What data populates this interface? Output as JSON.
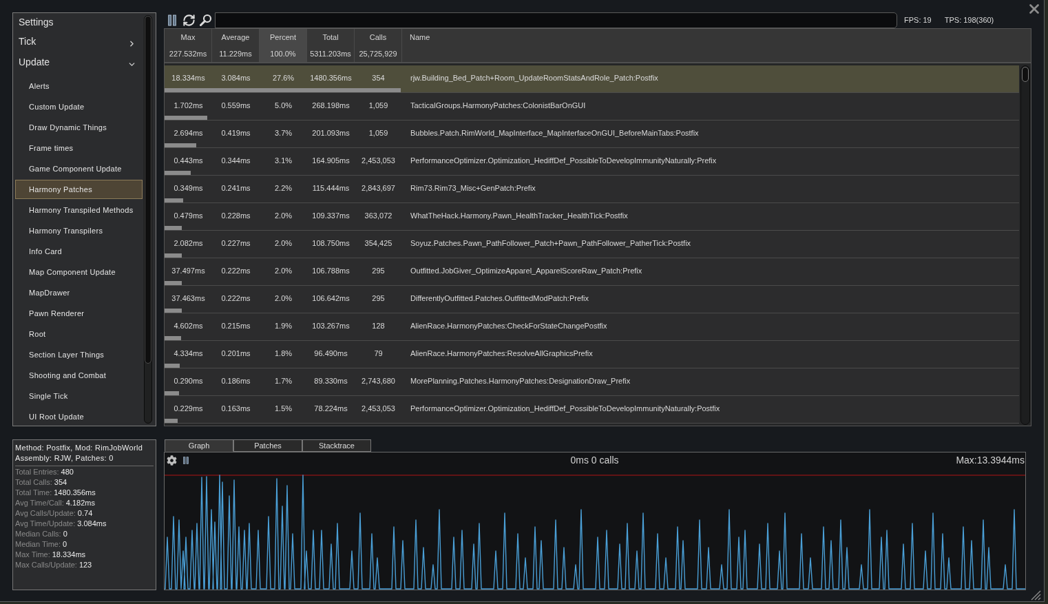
{
  "toolbar": {
    "fps": "FPS: 19",
    "tps": "TPS: 198(360)"
  },
  "sidebar": {
    "items": [
      {
        "label": "Settings",
        "kind": "link"
      },
      {
        "label": "Tick",
        "kind": "group",
        "expanded": false
      },
      {
        "label": "Update",
        "kind": "group",
        "expanded": true,
        "children": [
          {
            "label": "Alerts",
            "selected": false
          },
          {
            "label": "Custom Update",
            "selected": false
          },
          {
            "label": "Draw Dynamic Things",
            "selected": false
          },
          {
            "label": "Frame times",
            "selected": false
          },
          {
            "label": "Game Component Update",
            "selected": false
          },
          {
            "label": "Harmony Patches",
            "selected": true
          },
          {
            "label": "Harmony Transpiled Methods",
            "selected": false
          },
          {
            "label": "Harmony Transpilers",
            "selected": false
          },
          {
            "label": "Info Card",
            "selected": false
          },
          {
            "label": "Map Component Update",
            "selected": false
          },
          {
            "label": "MapDrawer",
            "selected": false
          },
          {
            "label": "Pawn Renderer",
            "selected": false
          },
          {
            "label": "Root",
            "selected": false
          },
          {
            "label": "Section Layer Things",
            "selected": false
          },
          {
            "label": "Shooting and Combat",
            "selected": false
          },
          {
            "label": "Single Tick",
            "selected": false
          },
          {
            "label": "UI Root Update",
            "selected": false
          }
        ]
      }
    ]
  },
  "table": {
    "columns": [
      {
        "label": "Max",
        "summary": "227.532ms",
        "selected": false
      },
      {
        "label": "Average",
        "summary": "11.229ms",
        "selected": false
      },
      {
        "label": "Percent",
        "summary": "100.0%",
        "selected": true
      },
      {
        "label": "Total",
        "summary": "5311.203ms",
        "selected": false
      },
      {
        "label": "Calls",
        "summary": "25,725,929",
        "selected": false
      },
      {
        "label": "Name",
        "selected": false
      }
    ],
    "rows": [
      {
        "cells": [
          "18.334ms",
          "3.084ms",
          "27.6%",
          "1480.356ms",
          "354",
          "rjw.Building_Bed_Patch+Room_UpdateRoomStatsAndRole_Patch:Postfix"
        ],
        "level": 0.276,
        "selected": true
      },
      {
        "cells": [
          "1.702ms",
          "0.559ms",
          "5.0%",
          "268.198ms",
          "1,059",
          "TacticalGroups.HarmonyPatches:ColonistBarOnGUI"
        ],
        "level": 0.05,
        "selected": false
      },
      {
        "cells": [
          "2.694ms",
          "0.419ms",
          "3.7%",
          "201.093ms",
          "1,059",
          "Bubbles.Patch.RimWorld_MapInterface_MapInterfaceOnGUI_BeforeMainTabs:Postfix"
        ],
        "level": 0.037,
        "selected": false
      },
      {
        "cells": [
          "0.443ms",
          "0.344ms",
          "3.1%",
          "164.905ms",
          "2,453,053",
          "PerformanceOptimizer.Optimization_HediffDef_PossibleToDevelopImmunityNaturally:Prefix"
        ],
        "level": 0.031,
        "selected": false
      },
      {
        "cells": [
          "0.349ms",
          "0.241ms",
          "2.2%",
          "115.444ms",
          "2,843,697",
          "Rim73.Rim73_Misc+GenPatch:Prefix"
        ],
        "level": 0.022,
        "selected": false
      },
      {
        "cells": [
          "0.479ms",
          "0.228ms",
          "2.0%",
          "109.337ms",
          "363,072",
          "WhatTheHack.Harmony.Pawn_HealthTracker_HealthTick:Postfix"
        ],
        "level": 0.02,
        "selected": false
      },
      {
        "cells": [
          "2.082ms",
          "0.227ms",
          "2.0%",
          "108.750ms",
          "354,425",
          "Soyuz.Patches.Pawn_PathFollower_Patch+Pawn_PathFollower_PatherTick:Postfix"
        ],
        "level": 0.02,
        "selected": false
      },
      {
        "cells": [
          "37.497ms",
          "0.222ms",
          "2.0%",
          "106.788ms",
          "295",
          "Outfitted.JobGiver_OptimizeApparel_ApparelScoreRaw_Patch:Prefix"
        ],
        "level": 0.02,
        "selected": false
      },
      {
        "cells": [
          "37.463ms",
          "0.222ms",
          "2.0%",
          "106.642ms",
          "295",
          "DifferentlyOutfitted.Patches.OutfittedModPatch:Prefix"
        ],
        "level": 0.02,
        "selected": false
      },
      {
        "cells": [
          "4.602ms",
          "0.215ms",
          "1.9%",
          "103.267ms",
          "128",
          "AlienRace.HarmonyPatches:CheckForStateChangePostfix"
        ],
        "level": 0.019,
        "selected": false
      },
      {
        "cells": [
          "4.334ms",
          "0.201ms",
          "1.8%",
          "96.490ms",
          "79",
          "AlienRace.HarmonyPatches:ResolveAllGraphicsPrefix"
        ],
        "level": 0.018,
        "selected": false
      },
      {
        "cells": [
          "0.290ms",
          "0.186ms",
          "1.7%",
          "89.330ms",
          "2,743,680",
          "MorePlanning.Patches.HarmonyPatches:DesignationDraw_Prefix"
        ],
        "level": 0.017,
        "selected": false
      },
      {
        "cells": [
          "0.229ms",
          "0.163ms",
          "1.5%",
          "78.224ms",
          "2,453,053",
          "PerformanceOptimizer.Optimization_HediffDef_PossibleToDevelopImmunityNaturally:Postfix"
        ],
        "level": 0.015,
        "selected": false
      }
    ]
  },
  "details": {
    "lines": [
      "Method: Postfix, Mod: RimJobWorld",
      "Assembly: RJW, Patches: 0"
    ],
    "stats": [
      {
        "label": "Total Entries:",
        "value": "480"
      },
      {
        "label": "Total Calls:",
        "value": "354"
      },
      {
        "label": "Total Time:",
        "value": "1480.356ms"
      },
      {
        "label": "Avg Time/Call:",
        "value": "4.182ms"
      },
      {
        "label": "Avg Calls/Update:",
        "value": "0.74"
      },
      {
        "label": "Avg Time/Update:",
        "value": "3.084ms"
      },
      {
        "label": "Median Calls:",
        "value": "0"
      },
      {
        "label": "Median Time:",
        "value": "0"
      },
      {
        "label": "Max Time:",
        "value": "18.334ms"
      },
      {
        "label": "Max Calls/Update:",
        "value": "123"
      }
    ]
  },
  "bottom_tabs": [
    {
      "label": "Graph",
      "selected": true
    },
    {
      "label": "Patches",
      "selected": false
    },
    {
      "label": "Stacktrace",
      "selected": false
    }
  ],
  "graph": {
    "title": "0ms 0 calls",
    "max_label": "Max:13.3944ms"
  }
}
